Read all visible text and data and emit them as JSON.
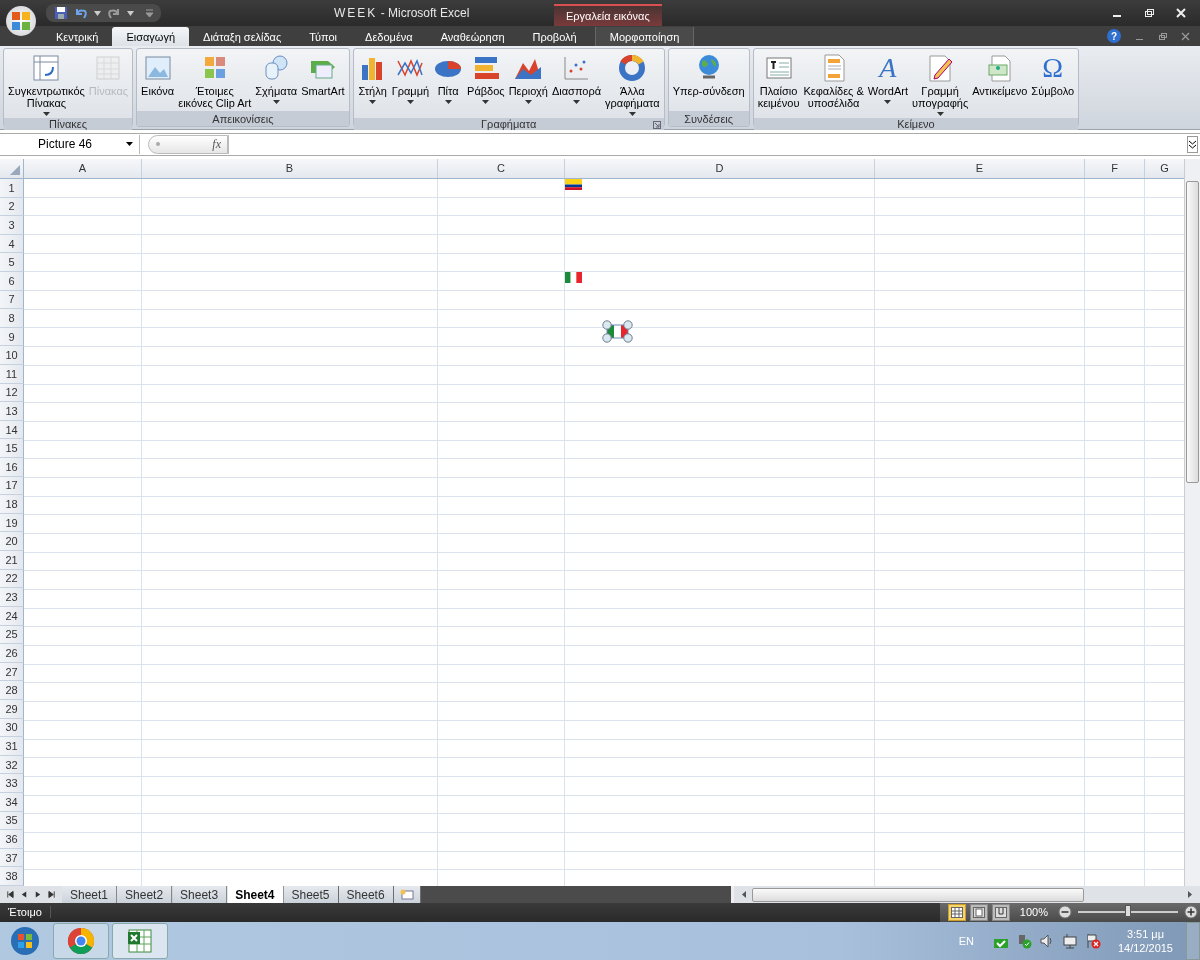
{
  "window": {
    "title_name": "WEEK",
    "title_app": "- Microsoft Excel",
    "context_header": "Εργαλεία εικόνας"
  },
  "tabs": [
    {
      "label": "Κεντρική",
      "selected": false,
      "kind": "normal"
    },
    {
      "label": "Εισαγωγή",
      "selected": true,
      "kind": "normal"
    },
    {
      "label": "Διάταξη σελίδας",
      "selected": false,
      "kind": "normal"
    },
    {
      "label": "Τύποι",
      "selected": false,
      "kind": "normal"
    },
    {
      "label": "Δεδομένα",
      "selected": false,
      "kind": "normal"
    },
    {
      "label": "Αναθεώρηση",
      "selected": false,
      "kind": "normal"
    },
    {
      "label": "Προβολή",
      "selected": false,
      "kind": "normal"
    },
    {
      "label": "Μορφοποίηση",
      "selected": false,
      "kind": "contextual"
    }
  ],
  "help_glyph": "?",
  "ribbon_groups": [
    {
      "title": "Πίνακες",
      "launcher": false,
      "buttons": [
        {
          "label": [
            "Συγκεντρωτικός",
            "Πίνακας"
          ],
          "dropdown": true,
          "disabled": false
        },
        {
          "label": [
            "Πίνακας"
          ],
          "dropdown": false,
          "disabled": true
        }
      ]
    },
    {
      "title": "Απεικονίσεις",
      "launcher": false,
      "buttons": [
        {
          "label": [
            "Εικόνα"
          ],
          "dropdown": false,
          "disabled": false
        },
        {
          "label": [
            "Έτοιμες",
            "εικόνες Clip Art"
          ],
          "dropdown": false,
          "disabled": false
        },
        {
          "label": [
            "Σχήματα"
          ],
          "dropdown": true,
          "disabled": false
        },
        {
          "label": [
            "SmartArt"
          ],
          "dropdown": false,
          "disabled": false
        }
      ]
    },
    {
      "title": "Γραφήματα",
      "launcher": true,
      "buttons": [
        {
          "label": [
            "Στήλη"
          ],
          "dropdown": true,
          "disabled": false
        },
        {
          "label": [
            "Γραμμή"
          ],
          "dropdown": true,
          "disabled": false
        },
        {
          "label": [
            "Πίτα"
          ],
          "dropdown": true,
          "disabled": false
        },
        {
          "label": [
            "Ράβδος"
          ],
          "dropdown": true,
          "disabled": false
        },
        {
          "label": [
            "Περιοχή"
          ],
          "dropdown": true,
          "disabled": false
        },
        {
          "label": [
            "Διασπορά"
          ],
          "dropdown": true,
          "disabled": false
        },
        {
          "label": [
            "Άλλα",
            "γραφήματα"
          ],
          "dropdown": true,
          "disabled": false
        }
      ]
    },
    {
      "title": "Συνδέσεις",
      "launcher": false,
      "buttons": [
        {
          "label": [
            "Υπερ-σύνδεση"
          ],
          "dropdown": false,
          "disabled": false
        }
      ]
    },
    {
      "title": "Κείμενο",
      "launcher": false,
      "buttons": [
        {
          "label": [
            "Πλαίσιο",
            "κειμένου"
          ],
          "dropdown": false,
          "disabled": false
        },
        {
          "label": [
            "Κεφαλίδες &",
            "υποσέλιδα"
          ],
          "dropdown": false,
          "disabled": false
        },
        {
          "label": [
            "WordArt"
          ],
          "dropdown": true,
          "disabled": false,
          "glyph": "A"
        },
        {
          "label": [
            "Γραμμή",
            "υπογραφής"
          ],
          "dropdown": true,
          "disabled": false
        },
        {
          "label": [
            "Αντικείμενο"
          ],
          "dropdown": false,
          "disabled": false
        },
        {
          "label": [
            "Σύμβολο"
          ],
          "dropdown": false,
          "disabled": false,
          "glyph": "Ω"
        }
      ]
    }
  ],
  "formula_bar": {
    "name_box": "Picture 46",
    "function_label": "fx"
  },
  "columns": [
    "A",
    "B",
    "C",
    "D",
    "E",
    "F",
    "G"
  ],
  "rows": [
    "1",
    "2",
    "3",
    "4",
    "5",
    "6",
    "7",
    "8",
    "9",
    "10",
    "11",
    "12",
    "13",
    "14",
    "15",
    "16",
    "17",
    "18",
    "19",
    "20",
    "21",
    "22",
    "23",
    "24",
    "25",
    "26",
    "27",
    "28",
    "29",
    "30",
    "31",
    "32",
    "33",
    "34",
    "35",
    "36",
    "37",
    "38"
  ],
  "pictures": [
    {
      "selected": false
    },
    {
      "selected": false
    },
    {
      "selected": true
    }
  ],
  "sheet_tabs": [
    {
      "label": "Sheet1",
      "selected": false
    },
    {
      "label": "Sheet2",
      "selected": false
    },
    {
      "label": "Sheet3",
      "selected": false
    },
    {
      "label": "Sheet4",
      "selected": true
    },
    {
      "label": "Sheet5",
      "selected": false
    },
    {
      "label": "Sheet6",
      "selected": false
    }
  ],
  "status_bar": {
    "text": "Έτοιμο",
    "views": [
      {
        "selected": true
      },
      {
        "selected": false
      },
      {
        "selected": false
      }
    ],
    "zoom": "100%",
    "zoom_slider": {
      "level": 0.5
    }
  },
  "taskbar": {
    "language": "EN",
    "time": "3:51 μμ",
    "date": "14/12/2015"
  }
}
